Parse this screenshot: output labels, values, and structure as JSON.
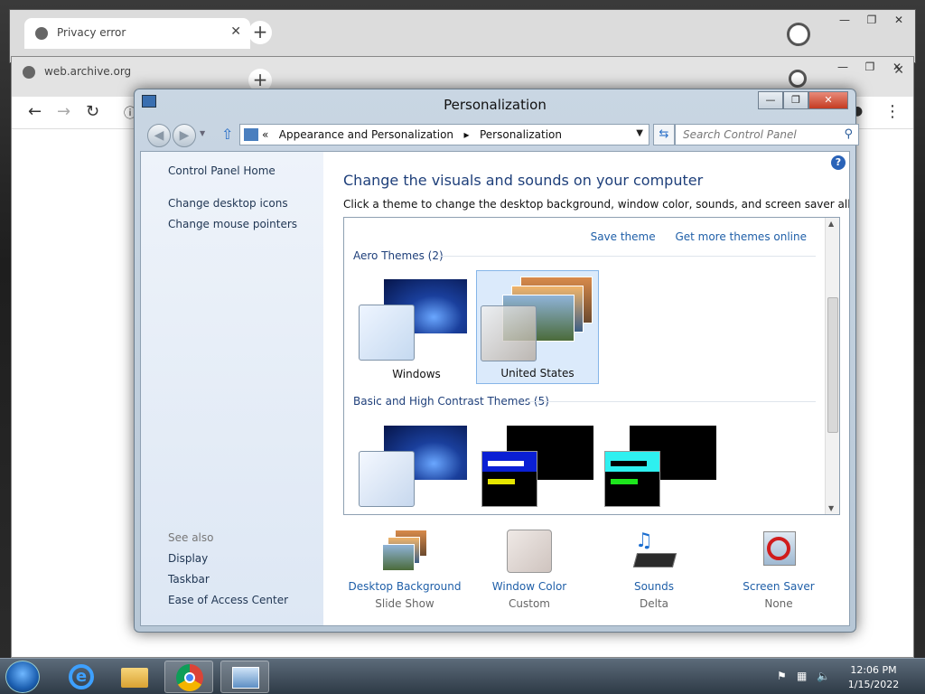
{
  "browser_back": {
    "tab_title": "Privacy error"
  },
  "browser_front": {
    "tab_title": "web.archive.org"
  },
  "window": {
    "title": "Personalization"
  },
  "address": {
    "breadcrumb_prefix": "«",
    "crumb1": "Appearance and Personalization",
    "separator": "▸",
    "crumb2": "Personalization",
    "search_placeholder": "Search Control Panel"
  },
  "sidebar": {
    "home": "Control Panel Home",
    "links": [
      "Change desktop icons",
      "Change mouse pointers"
    ],
    "see_also_label": "See also",
    "see_also": [
      "Display",
      "Taskbar",
      "Ease of Access Center"
    ]
  },
  "main": {
    "heading": "Change the visuals and sounds on your computer",
    "description": "Click a theme to change the desktop background, window color, sounds, and screen saver all at once.",
    "save_theme": "Save theme",
    "more_themes": "Get more themes online",
    "aero_group": "Aero Themes (2)",
    "basic_group": "Basic and High Contrast Themes (5)",
    "themes": [
      {
        "label": "Windows",
        "selected": false
      },
      {
        "label": "United States",
        "selected": true
      }
    ]
  },
  "settings": [
    {
      "name": "Desktop Background",
      "value": "Slide Show",
      "icon": "photo-stack-icon"
    },
    {
      "name": "Window Color",
      "value": "Custom",
      "icon": "window-color-icon"
    },
    {
      "name": "Sounds",
      "value": "Delta",
      "icon": "sound-keyboard-icon"
    },
    {
      "name": "Screen Saver",
      "value": "None",
      "icon": "screen-saver-icon"
    }
  ],
  "taskbar": {
    "time": "12:06 PM",
    "date": "1/15/2022"
  },
  "colors": {
    "link": "#1f5fa8",
    "heading": "#1e3f7a",
    "selected_theme": "#dbeafb"
  }
}
